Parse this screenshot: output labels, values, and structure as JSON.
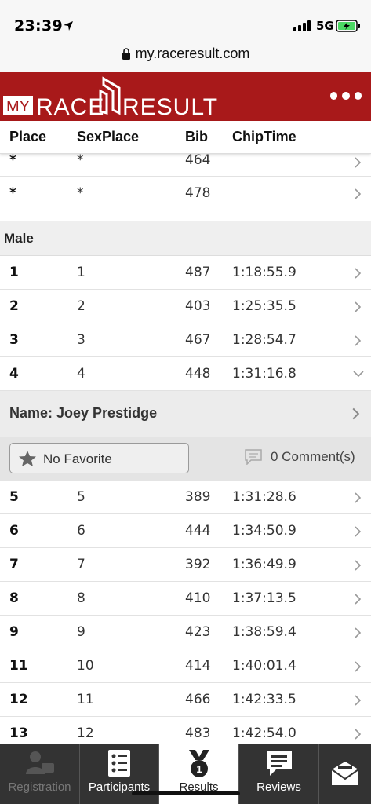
{
  "status_bar": {
    "time": "23:39",
    "network": "5G"
  },
  "url_bar": {
    "url": "my.raceresult.com"
  },
  "brand": {
    "logo_my": "MY",
    "logo_text": "RACE RESULT"
  },
  "columns": {
    "place": "Place",
    "sexplace": "SexPlace",
    "bib": "Bib",
    "chiptime": "ChipTime"
  },
  "top_rows": [
    {
      "place": "*",
      "sexplace": "*",
      "bib": "464",
      "chiptime": ""
    },
    {
      "place": "*",
      "sexplace": "*",
      "bib": "478",
      "chiptime": ""
    }
  ],
  "group": {
    "title": "Male"
  },
  "rows_before": [
    {
      "place": "1",
      "sexplace": "1",
      "bib": "487",
      "chiptime": "1:18:55.9"
    },
    {
      "place": "2",
      "sexplace": "2",
      "bib": "403",
      "chiptime": "1:25:35.5"
    },
    {
      "place": "3",
      "sexplace": "3",
      "bib": "467",
      "chiptime": "1:28:54.7"
    },
    {
      "place": "4",
      "sexplace": "4",
      "bib": "448",
      "chiptime": "1:31:16.8"
    }
  ],
  "expanded": {
    "name_label": "Name:  Joey Prestidge",
    "favorite_label": "No Favorite",
    "comments_label": "0 Comment(s)"
  },
  "rows_after": [
    {
      "place": "5",
      "sexplace": "5",
      "bib": "389",
      "chiptime": "1:31:28.6"
    },
    {
      "place": "6",
      "sexplace": "6",
      "bib": "444",
      "chiptime": "1:34:50.9"
    },
    {
      "place": "7",
      "sexplace": "7",
      "bib": "392",
      "chiptime": "1:36:49.9"
    },
    {
      "place": "8",
      "sexplace": "8",
      "bib": "410",
      "chiptime": "1:37:13.5"
    },
    {
      "place": "9",
      "sexplace": "9",
      "bib": "423",
      "chiptime": "1:38:59.4"
    },
    {
      "place": "11",
      "sexplace": "10",
      "bib": "414",
      "chiptime": "1:40:01.4"
    },
    {
      "place": "12",
      "sexplace": "11",
      "bib": "466",
      "chiptime": "1:42:33.5"
    },
    {
      "place": "13",
      "sexplace": "12",
      "bib": "483",
      "chiptime": "1:42:54.0"
    }
  ],
  "tabs": [
    {
      "label": "Registration",
      "icon": "registration-icon",
      "state": "disabled"
    },
    {
      "label": "Participants",
      "icon": "participants-icon",
      "state": "normal"
    },
    {
      "label": "Results",
      "icon": "results-medal-icon",
      "state": "active"
    },
    {
      "label": "Reviews",
      "icon": "reviews-icon",
      "state": "normal"
    },
    {
      "label": "",
      "icon": "mail-icon",
      "state": "normal"
    }
  ],
  "colors": {
    "brand_red": "#a8191a",
    "tabbar_bg": "#333333",
    "group_bg": "#efefef"
  }
}
